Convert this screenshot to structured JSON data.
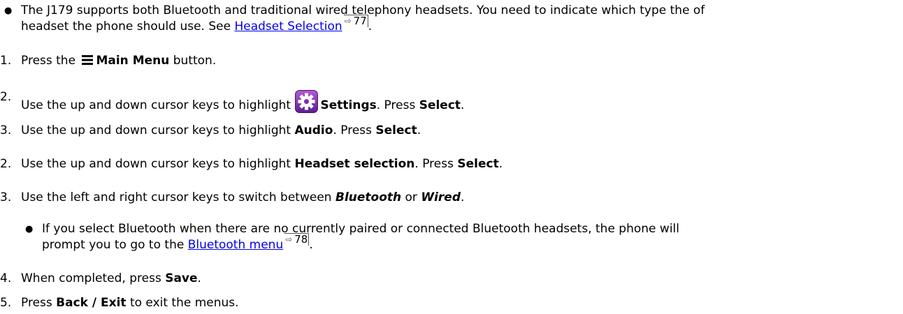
{
  "intro": {
    "part1": "The J179 supports both Bluetooth and traditional wired telephony headsets. You need to indicate which type the of",
    "part2": "headset the phone should use. See ",
    "link": "Headset Selection",
    "ref": "77",
    "end": "."
  },
  "steps": [
    {
      "num": "1.",
      "pre": "Press the ",
      "bold": "Main Menu",
      "post": " button."
    },
    {
      "num": "2.",
      "pre": "Use the up and down cursor keys to highlight ",
      "bold": "Settings",
      "mid": ". Press ",
      "bold2": "Select",
      "post": "."
    },
    {
      "num": "3.",
      "pre": "Use the up and down cursor keys to highlight ",
      "bold": "Audio",
      "mid": ". Press ",
      "bold2": "Select",
      "post": "."
    },
    {
      "num": "2.",
      "pre": "Use the up and down cursor keys to highlight ",
      "bold": "Headset selection",
      "mid": ". Press ",
      "bold2": "Select",
      "post": "."
    },
    {
      "num": "3.",
      "pre": "Use the left and right cursor keys to switch between ",
      "bold": "Bluetooth",
      "mid": " or ",
      "bold2": "Wired",
      "post": "."
    },
    {
      "num": "4.",
      "pre": "When completed, press ",
      "bold": "Save",
      "post": "."
    },
    {
      "num": "5.",
      "pre": "Press ",
      "bold": "Back / Exit",
      "post": " to exit the menus."
    }
  ],
  "subnote": {
    "part1": "If you select Bluetooth when there are no currently paired or connected Bluetooth headsets, the phone will",
    "part2": "prompt you to go to the ",
    "link": "Bluetooth menu",
    "ref": "78",
    "end": "."
  },
  "icons": {
    "menu": "hamburger-menu-icon",
    "settings": "gear-settings-icon",
    "settings_color": "#7a2fb0",
    "link_color": "#0000ee"
  }
}
